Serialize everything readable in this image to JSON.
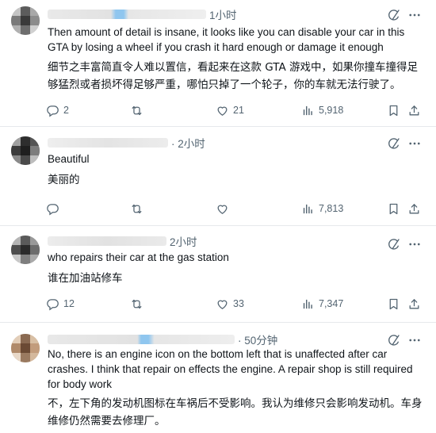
{
  "replies": [
    {
      "time": "1小时",
      "text_en": "Then amount of detail is insane, it looks like you can disable your car in this GTA by losing a wheel if you crash it hard enough or damage it enough",
      "text_zh": "细节之丰富简直令人难以置信，看起来在这款 GTA 游戏中，如果你撞车撞得足够猛烈或者损坏得足够严重，哪怕只掉了一个轮子，你的车就无法行驶了。",
      "replies_count": "2",
      "retweets_count": "",
      "likes_count": "21",
      "views_count": "5,918"
    },
    {
      "time": "· 2小时",
      "text_en": "Beautiful",
      "text_zh": "美丽的",
      "replies_count": "",
      "retweets_count": "",
      "likes_count": "",
      "views_count": "7,813"
    },
    {
      "time": "2小时",
      "text_en": "who repairs their car at the gas station",
      "text_zh": "谁在加油站修车",
      "replies_count": "12",
      "retweets_count": "",
      "likes_count": "33",
      "views_count": "7,347"
    },
    {
      "time": "· 50分钟",
      "text_en": "No, there is an engine icon on the bottom left that is unaffected after car crashes. I think that repair on effects the engine. A repair shop is still required for body work",
      "text_zh": "不，左下角的发动机图标在车祸后不受影响。我认为维修只会影响发动机。车身维修仍然需要去修理厂。"
    }
  ],
  "icons": {
    "reply": "reply-bubble-icon",
    "retweet": "retweet-icon",
    "like": "heart-icon",
    "views": "views-bar-chart-icon",
    "bookmark": "bookmark-icon",
    "share": "share-upload-icon",
    "grok": "grok-slash-icon",
    "more": "more-dots-icon"
  },
  "colors": {
    "text_primary": "#0f1419",
    "text_secondary": "#536471",
    "divider": "#e6e9ec",
    "redaction_accent": "#8fc6ef"
  }
}
